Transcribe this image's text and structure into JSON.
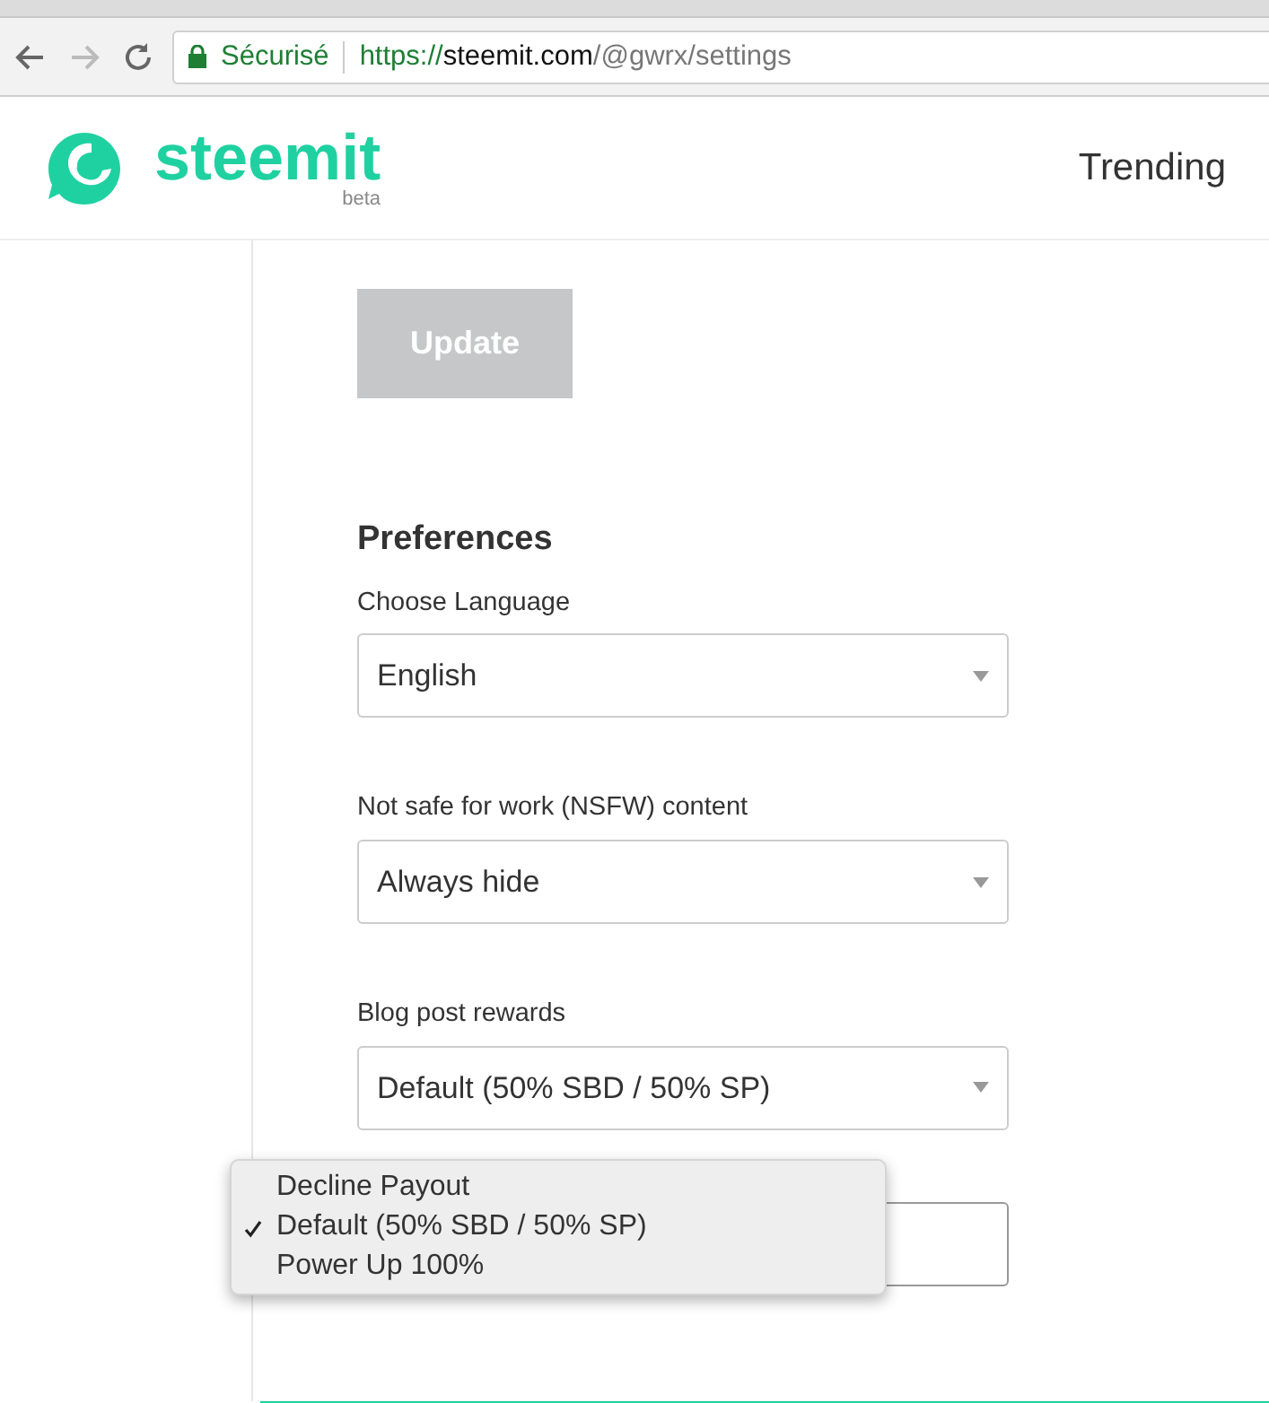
{
  "browser": {
    "secure_label": "Sécurisé",
    "url_scheme": "https://",
    "url_host": "steemit.com",
    "url_path": "/@gwrx/settings"
  },
  "header": {
    "logo_text": "steemit",
    "logo_badge": "beta",
    "nav": [
      {
        "label": "Trending"
      }
    ]
  },
  "update_button": {
    "label": "Update",
    "disabled": true
  },
  "preferences": {
    "title": "Preferences",
    "fields": [
      {
        "label": "Choose Language",
        "value": "English"
      },
      {
        "label": "Not safe for work (NSFW) content",
        "value": "Always hide"
      },
      {
        "label": "Blog post rewards",
        "value": "Default (50% SBD / 50% SP)"
      }
    ]
  },
  "open_dropdown": {
    "options": [
      {
        "label": "Decline Payout",
        "selected": false
      },
      {
        "label": "Default (50% SBD / 50% SP)",
        "selected": true
      },
      {
        "label": "Power Up 100%",
        "selected": false
      }
    ]
  }
}
